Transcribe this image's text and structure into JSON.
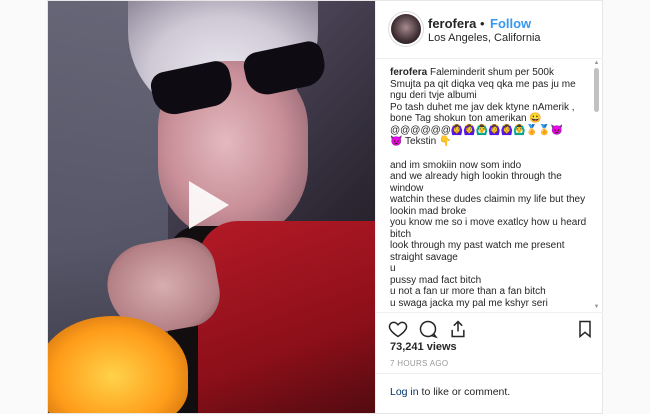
{
  "post": {
    "username": "ferofera",
    "follow_label": "Follow",
    "follow_separator": "•",
    "location": "Los Angeles, California",
    "caption_user": "ferofera",
    "caption_lines": [
      "Faleminderit shum per 500k",
      "Smujta pa qit diqka veq qka me pas ju me ngu deri tvje albumi",
      "Po tash duhet me jav dek ktyne nAmerik , bone Tag shokun ton amerikan 😀",
      "@@@@@@🙆‍♀️🙆‍♀️🙆‍♂️🙆‍♀️🙆‍♀️🙆‍♂️🏅🏅😈",
      "😈 Tekstin 👇"
    ],
    "lyrics_lines": [
      "and im smokiin now som indo",
      "and we already high lookin through the window",
      "watchin these dudes claimin my life but they lookin mad broke",
      "you know me so i move exatlcy how u heard bitch",
      "look through my past watch me present straight savage",
      "u",
      "pussy mad fact bitch",
      "u not a fan ur more than a fan bitch",
      "u swaga jacka my pal me kshyr seri"
    ],
    "likes": "73,241 views",
    "timestamp": "7 HOURS AGO",
    "login_link": "Log in",
    "login_rest": " to like or comment."
  },
  "media": {
    "type": "video",
    "play_icon": "play-icon"
  },
  "icons": [
    "heart-icon",
    "comment-icon",
    "share-icon",
    "bookmark-icon",
    "verified-icon"
  ],
  "colors": {
    "link": "#3897f0",
    "text": "#262626",
    "muted": "#999999",
    "login_link": "#003569"
  }
}
